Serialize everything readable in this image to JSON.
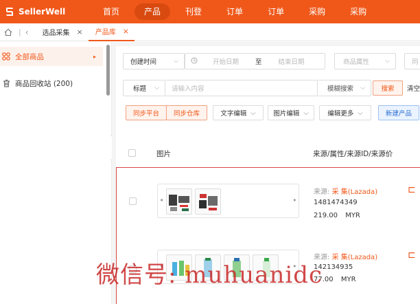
{
  "brand": {
    "name": "SellerWell",
    "color": "#f0581a"
  },
  "nav": {
    "items": [
      {
        "label": "首页",
        "active": false
      },
      {
        "label": "产品",
        "active": true
      },
      {
        "label": "刊登",
        "active": false
      },
      {
        "label": "订单",
        "active": false
      },
      {
        "label": "订单",
        "active": false
      },
      {
        "label": "采购",
        "active": false
      },
      {
        "label": "采购",
        "active": false
      }
    ]
  },
  "tabs": [
    {
      "label": "选品采集",
      "active": false
    },
    {
      "label": "产品库",
      "active": true
    }
  ],
  "sidebar": {
    "items": [
      {
        "label": "全部商品",
        "icon": "grid-icon",
        "active": true
      },
      {
        "label": "商品回收站 (200)",
        "icon": "trash-icon",
        "active": false
      }
    ]
  },
  "filters": {
    "create_time": "创建时间",
    "start_date": "开始日期",
    "to": "至",
    "end_date": "结束日期",
    "attribute": "商品属性",
    "attribute_next": "同",
    "title_select": "标题",
    "search_placeholder": "请输入内容",
    "fuzzy_search": "模糊搜索",
    "search_button": "搜索",
    "clear_button": "清空"
  },
  "toolbar": {
    "sync_platform": "同步平台",
    "sync_warehouse": "同步仓库",
    "text_edit": "文字编辑",
    "image_edit": "图片编辑",
    "edit_more": "编辑更多",
    "new_product": "新建产品"
  },
  "table": {
    "headers": {
      "image": "图片",
      "source": "来源/属性/来源ID/来源价"
    },
    "rows": [
      {
        "source_label": "来源:",
        "source_value": "采 集(Lazada)",
        "source_id": "1481474349",
        "price": "219.00",
        "currency": "MYR",
        "thumb_count": 2
      },
      {
        "source_label": "来源:",
        "source_value": "采 集(Lazada)",
        "source_id": "142134935",
        "price": "77.00",
        "currency": "MYR",
        "thumb_count": 4
      }
    ]
  },
  "watermark": "微信号: muhuanidc"
}
